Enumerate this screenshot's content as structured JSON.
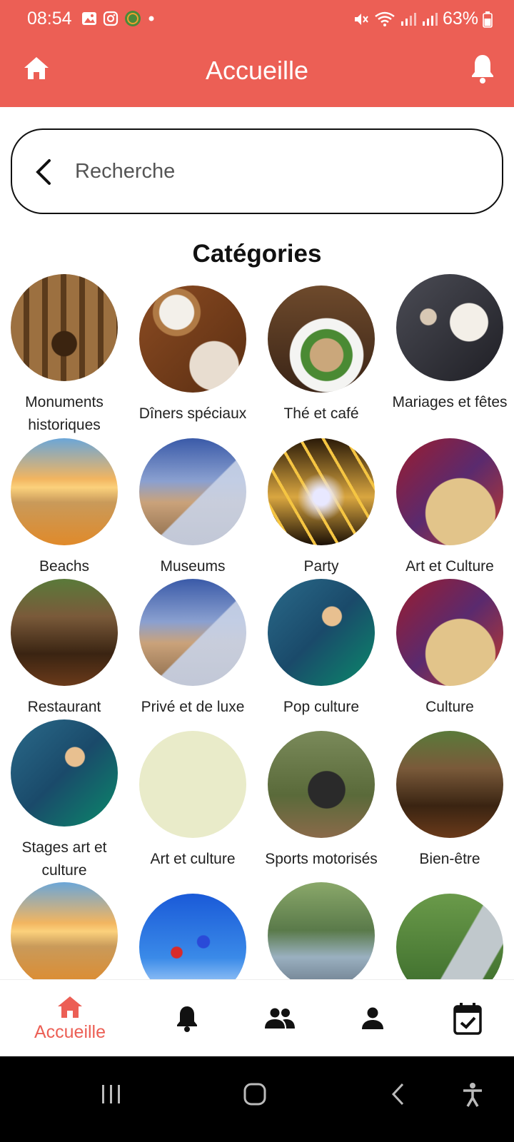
{
  "status_bar": {
    "time": "08:54",
    "battery": "63%"
  },
  "app_bar": {
    "title": "Accueille"
  },
  "search": {
    "placeholder": "Recherche"
  },
  "section": {
    "title": "Catégories"
  },
  "categories": [
    {
      "label": "Monuments historiques",
      "image": "colosseum"
    },
    {
      "label": "Dîners spéciaux",
      "image": "coffee-croissant"
    },
    {
      "label": "Thé et café",
      "image": "food-plate"
    },
    {
      "label": "Mariages et fêtes",
      "image": "wedding-couple"
    },
    {
      "label": "Beachs",
      "image": "beach-sunset"
    },
    {
      "label": "Museums",
      "image": "louvre"
    },
    {
      "label": "Party",
      "image": "concert"
    },
    {
      "label": "Art et Culture",
      "image": "pottery"
    },
    {
      "label": "Restaurant",
      "image": "restaurant-interior"
    },
    {
      "label": "Privé et de luxe",
      "image": "louvre"
    },
    {
      "label": "Pop culture",
      "image": "costume-dancer"
    },
    {
      "label": "Culture",
      "image": "pottery"
    },
    {
      "label": "Stages art et culture",
      "image": "costume-dancer"
    },
    {
      "label": "Art et culture",
      "image": "blank"
    },
    {
      "label": "Sports motorisés",
      "image": "quad-bike"
    },
    {
      "label": "Bien-être",
      "image": "restaurant-interior"
    },
    {
      "label": "",
      "image": "beach-sunset"
    },
    {
      "label": "",
      "image": "skydivers"
    },
    {
      "label": "",
      "image": "family-river"
    },
    {
      "label": "",
      "image": "child-slide"
    }
  ],
  "bottom_nav": {
    "items": [
      {
        "label": "Accueille",
        "icon": "home-icon",
        "active": true
      },
      {
        "label": "",
        "icon": "bell-icon"
      },
      {
        "label": "",
        "icon": "group-icon"
      },
      {
        "label": "",
        "icon": "person-icon"
      },
      {
        "label": "",
        "icon": "calendar-check-icon"
      }
    ]
  },
  "colors": {
    "accent": "#EC5F55",
    "background": "#FFFFFF"
  }
}
